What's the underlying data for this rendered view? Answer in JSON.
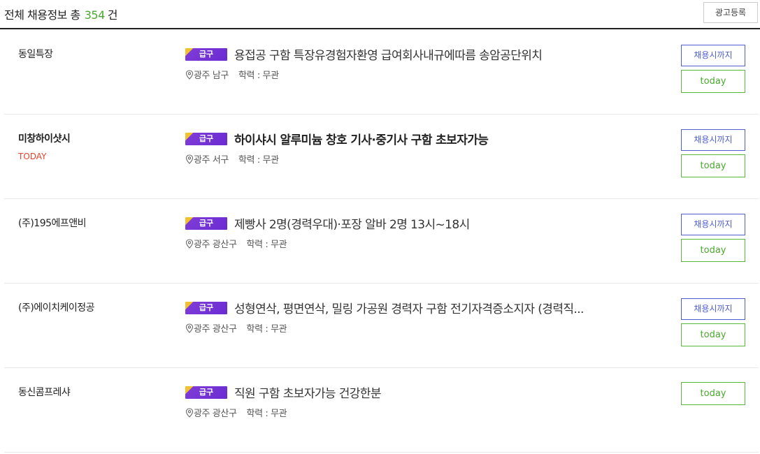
{
  "header": {
    "title_prefix": "전체 채용정보 총",
    "count": "354",
    "title_suffix": "건",
    "ad_button": "광고등록"
  },
  "jobs": [
    {
      "company": "동일특장",
      "badge": "급구",
      "title": "용접공 구함 특장유경험자환영 급여회사내규에따름 송암공단위치",
      "location": "광주 남구",
      "education": "학력 : 무관",
      "apply_label": "채용시까지",
      "deadline_label": "today"
    },
    {
      "company": "미창하이샷시",
      "company_tag": "TODAY",
      "badge": "급구",
      "title": "하이샤시 알루미늄 창호 기사·중기사 구함 초보자가능",
      "location": "광주 서구",
      "education": "학력 : 무관",
      "apply_label": "채용시까지",
      "deadline_label": "today"
    },
    {
      "company": "(주)195에프앤비",
      "badge": "급구",
      "title": "제빵사 2명(경력우대)·포장 알바 2명 13시~18시",
      "location": "광주 광산구",
      "education": "학력 : 무관",
      "apply_label": "채용시까지",
      "deadline_label": "today"
    },
    {
      "company": "(주)에이치케이정공",
      "badge": "급구",
      "title": "성형연삭, 평면연삭, 밀링 가공원 경력자 구함 전기자격증소지자 (경력직...",
      "location": "광주 광산구",
      "education": "학력 : 무관",
      "apply_label": "채용시까지",
      "deadline_label": "today"
    },
    {
      "company": "동신콤프레샤",
      "badge": "급구",
      "title": "직원 구함 초보자가능 건강한분",
      "location": "광주 광산구",
      "education": "학력 : 무관",
      "deadline_label": "today"
    }
  ],
  "colors": {
    "count_green": "#4aa82f",
    "today_red": "#e8432e",
    "apply_blue": "#4f5fd3",
    "deadline_green": "#5ab93a",
    "badge_purple": "#6a2bd2",
    "badge_yellow": "#f2c12e"
  },
  "icons": {
    "location": "map-pin-icon"
  }
}
